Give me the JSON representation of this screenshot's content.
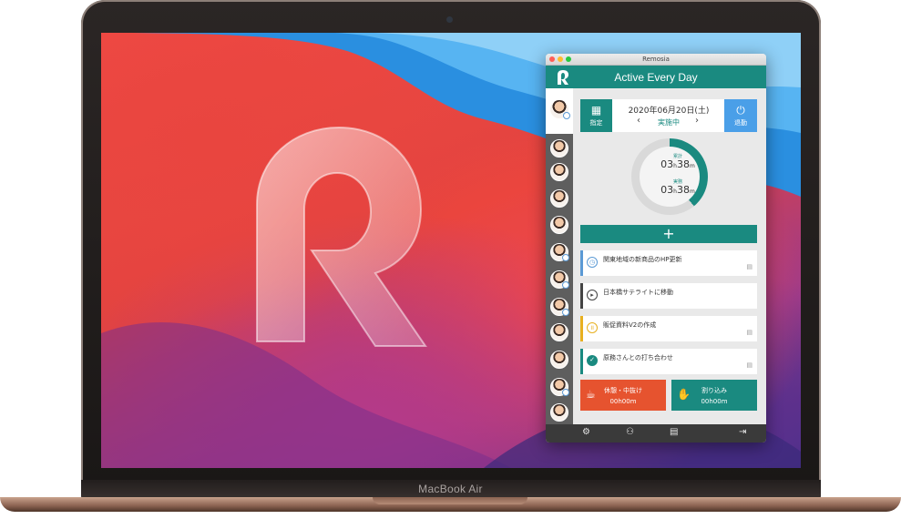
{
  "device": {
    "model_label": "MacBook Air"
  },
  "window": {
    "title": "Remosia"
  },
  "app": {
    "header": "Active Every Day",
    "date_selector": {
      "calendar_label": "指定",
      "date": "2020年06月20日(土)",
      "status": "実施中",
      "prev": "‹",
      "next": "›",
      "leave_label": "退勤"
    },
    "timer": {
      "total_label": "累計",
      "total_value": "03",
      "total_unit_h": "h",
      "total_minutes": "38",
      "total_unit_m": "m",
      "actual_label": "実務",
      "actual_value": "03",
      "actual_unit_h": "h",
      "actual_minutes": "38",
      "actual_unit_m": "m",
      "progress_percent": 39
    },
    "add_label": "+",
    "tasks": [
      {
        "label": "関東地域の新商品のHP更新",
        "icon": "clock-icon",
        "color": "#5b9ad5"
      },
      {
        "label": "日本橋サテライトに移動",
        "icon": "play-icon",
        "color": "#444444"
      },
      {
        "label": "販促資料V2の作成",
        "icon": "pause-icon",
        "color": "#e8b020"
      },
      {
        "label": "原務さんとの打ち合わせ",
        "icon": "check-icon",
        "color": "#1a8a80"
      }
    ],
    "break_button": {
      "label": "休憩・中抜け",
      "time": "00h00m"
    },
    "interrupt_button": {
      "label": "割り込み",
      "time": "00h00m"
    },
    "footer_icons": [
      "gear-icon",
      "user-icon",
      "document-icon",
      "logout-icon"
    ]
  },
  "colors": {
    "accent": "#1a8a80",
    "break": "#e6532f",
    "leave": "#4a9fe8"
  }
}
